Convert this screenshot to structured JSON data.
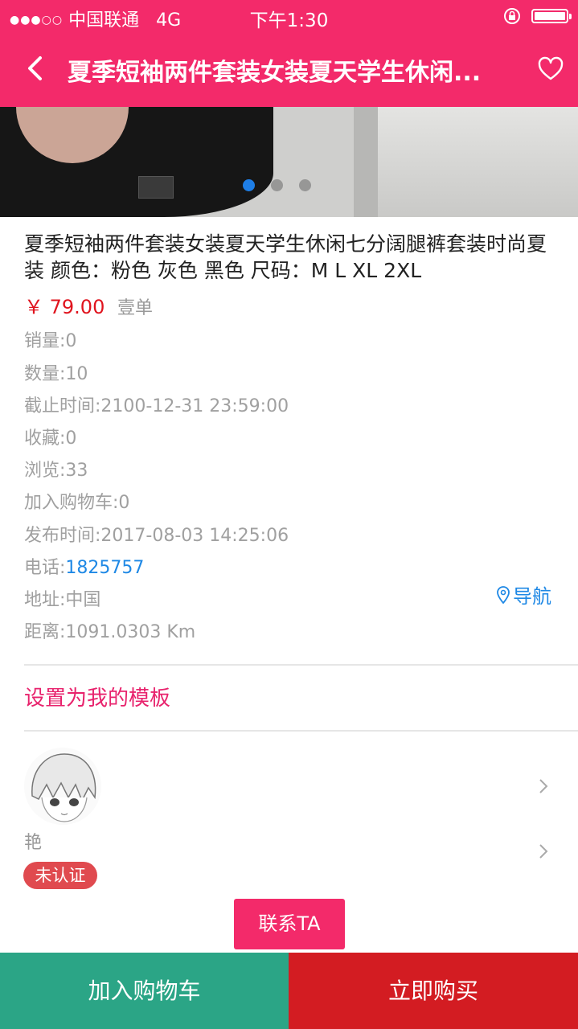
{
  "status_bar": {
    "signal_dots": "●●●○○",
    "carrier": "中国联通",
    "network": "4G",
    "time": "下午1:30"
  },
  "header": {
    "title": "夏季短袖两件套装女装夏天学生休闲...",
    "back_icon": "chevron-left-icon",
    "favorite_icon": "heart-outline-icon"
  },
  "carousel": {
    "page_count": 3,
    "active_index": 0
  },
  "product": {
    "description": "夏季短袖两件套装女装夏天学生休闲七分阔腿裤套装时尚夏装 颜色：粉色 灰色 黑色 尺码：M L XL 2XL",
    "price": "￥ 79.00",
    "unit": "壹单"
  },
  "details": {
    "sales": "销量:0",
    "quantity": "数量:10",
    "deadline": "截止时间:2100-12-31 23:59:00",
    "favorites": "收藏:0",
    "views": "浏览:33",
    "cart_adds": "加入购物车:0",
    "publish_time": "发布时间:2017-08-03 14:25:06",
    "phone_label": "电话:",
    "phone_value": "1825757",
    "address": "地址:中国",
    "distance": "距离:1091.0303 Km",
    "nav_label": "导航"
  },
  "template_link": "设置为我的模板",
  "seller": {
    "name": "艳",
    "badge": "未认证"
  },
  "actions": {
    "contact": "联系TA",
    "add_to_cart": "加入购物车",
    "buy_now": "立即购买"
  },
  "colors": {
    "brand_pink": "#f32a6a",
    "cart_green": "#2ba586",
    "buy_red": "#d31c22",
    "price_red": "#e0141e",
    "link_blue": "#1e88e5"
  }
}
